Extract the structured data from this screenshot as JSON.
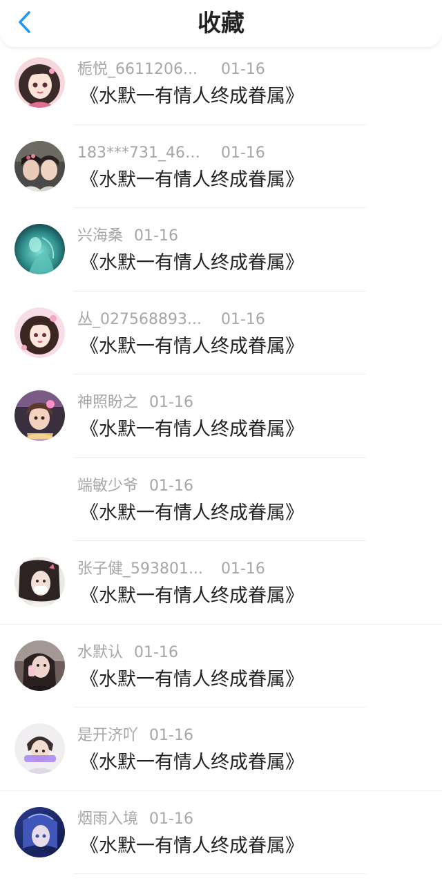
{
  "header": {
    "title": "收藏",
    "back_icon": "chevron-left-icon",
    "accent_color": "#2196F3"
  },
  "items": [
    {
      "name": "栀悦_6611206...",
      "date": "01-16",
      "content": "《水默一有情人终成眷属》",
      "avatar": true
    },
    {
      "name": "183***731_464...",
      "date": "01-16",
      "content": "《水默一有情人终成眷属》",
      "avatar": true
    },
    {
      "name": "兴海桑",
      "date": "01-16",
      "content": "《水默一有情人终成眷属》",
      "avatar": true
    },
    {
      "name": "丛_027568893...",
      "date": "01-16",
      "content": "《水默一有情人终成眷属》",
      "avatar": true
    },
    {
      "name": "神照盼之",
      "date": "01-16",
      "content": "《水默一有情人终成眷属》",
      "avatar": true
    },
    {
      "name": "端敏少爷",
      "date": "01-16",
      "content": "《水默一有情人终成眷属》",
      "avatar": false
    },
    {
      "name": "张子健_593801...",
      "date": "01-16",
      "content": "《水默一有情人终成眷属》",
      "avatar": true
    },
    {
      "name": "水默认",
      "date": "01-16",
      "content": "《水默一有情人终成眷属》",
      "avatar": true
    },
    {
      "name": "是开济吖",
      "date": "01-16",
      "content": "《水默一有情人终成眷属》",
      "avatar": true
    },
    {
      "name": "烟雨入境",
      "date": "01-16",
      "content": "《水默一有情人终成眷属》",
      "avatar": true
    }
  ]
}
